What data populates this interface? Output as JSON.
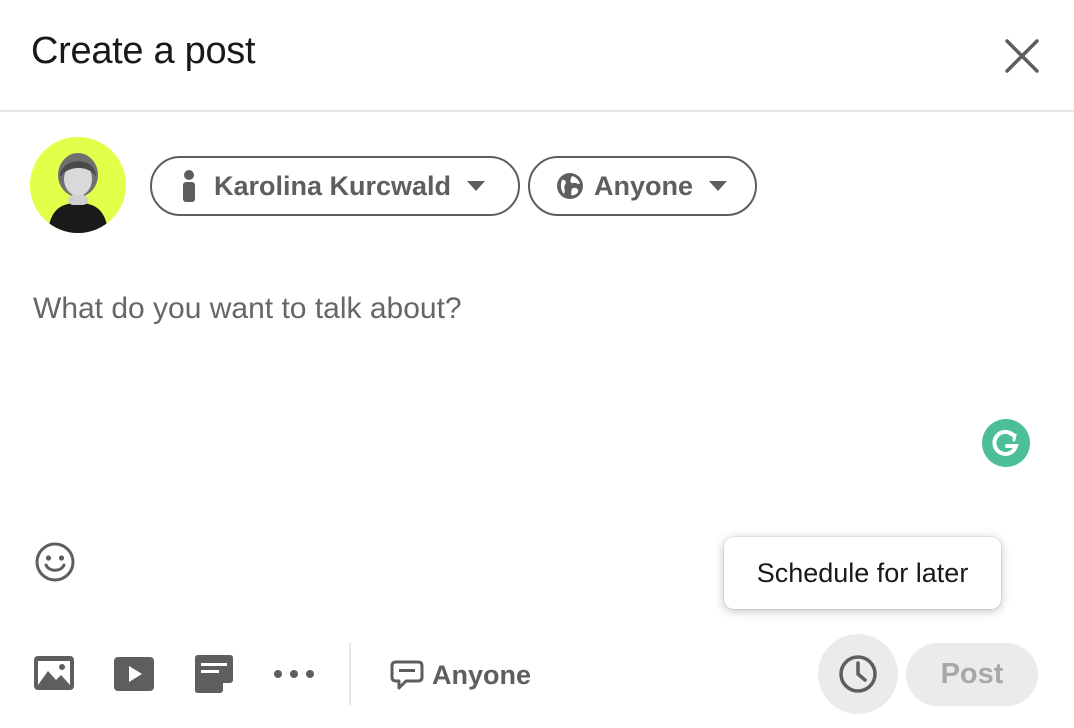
{
  "dialog": {
    "title": "Create a post",
    "close_icon": "close-icon"
  },
  "author": {
    "name": "Karolina Kurcwald",
    "avatar_bg": "#e2ff4a",
    "icon": "person-icon"
  },
  "visibility": {
    "label": "Anyone",
    "icon": "globe-icon"
  },
  "composer": {
    "placeholder": "What do you want to talk about?"
  },
  "tooltip": {
    "text": "Schedule for later"
  },
  "toolbar": {
    "icons": [
      "photo-icon",
      "video-icon",
      "document-icon",
      "more-icon"
    ],
    "comment_control": {
      "label": "Anyone",
      "icon": "comment-icon"
    },
    "schedule_icon": "clock-icon",
    "post_label": "Post"
  },
  "colors": {
    "grammarly": "#4cbf96",
    "icon_gray": "#5e5e5e",
    "disabled_bg": "#ebebeb",
    "disabled_text": "#a8a8a8"
  }
}
